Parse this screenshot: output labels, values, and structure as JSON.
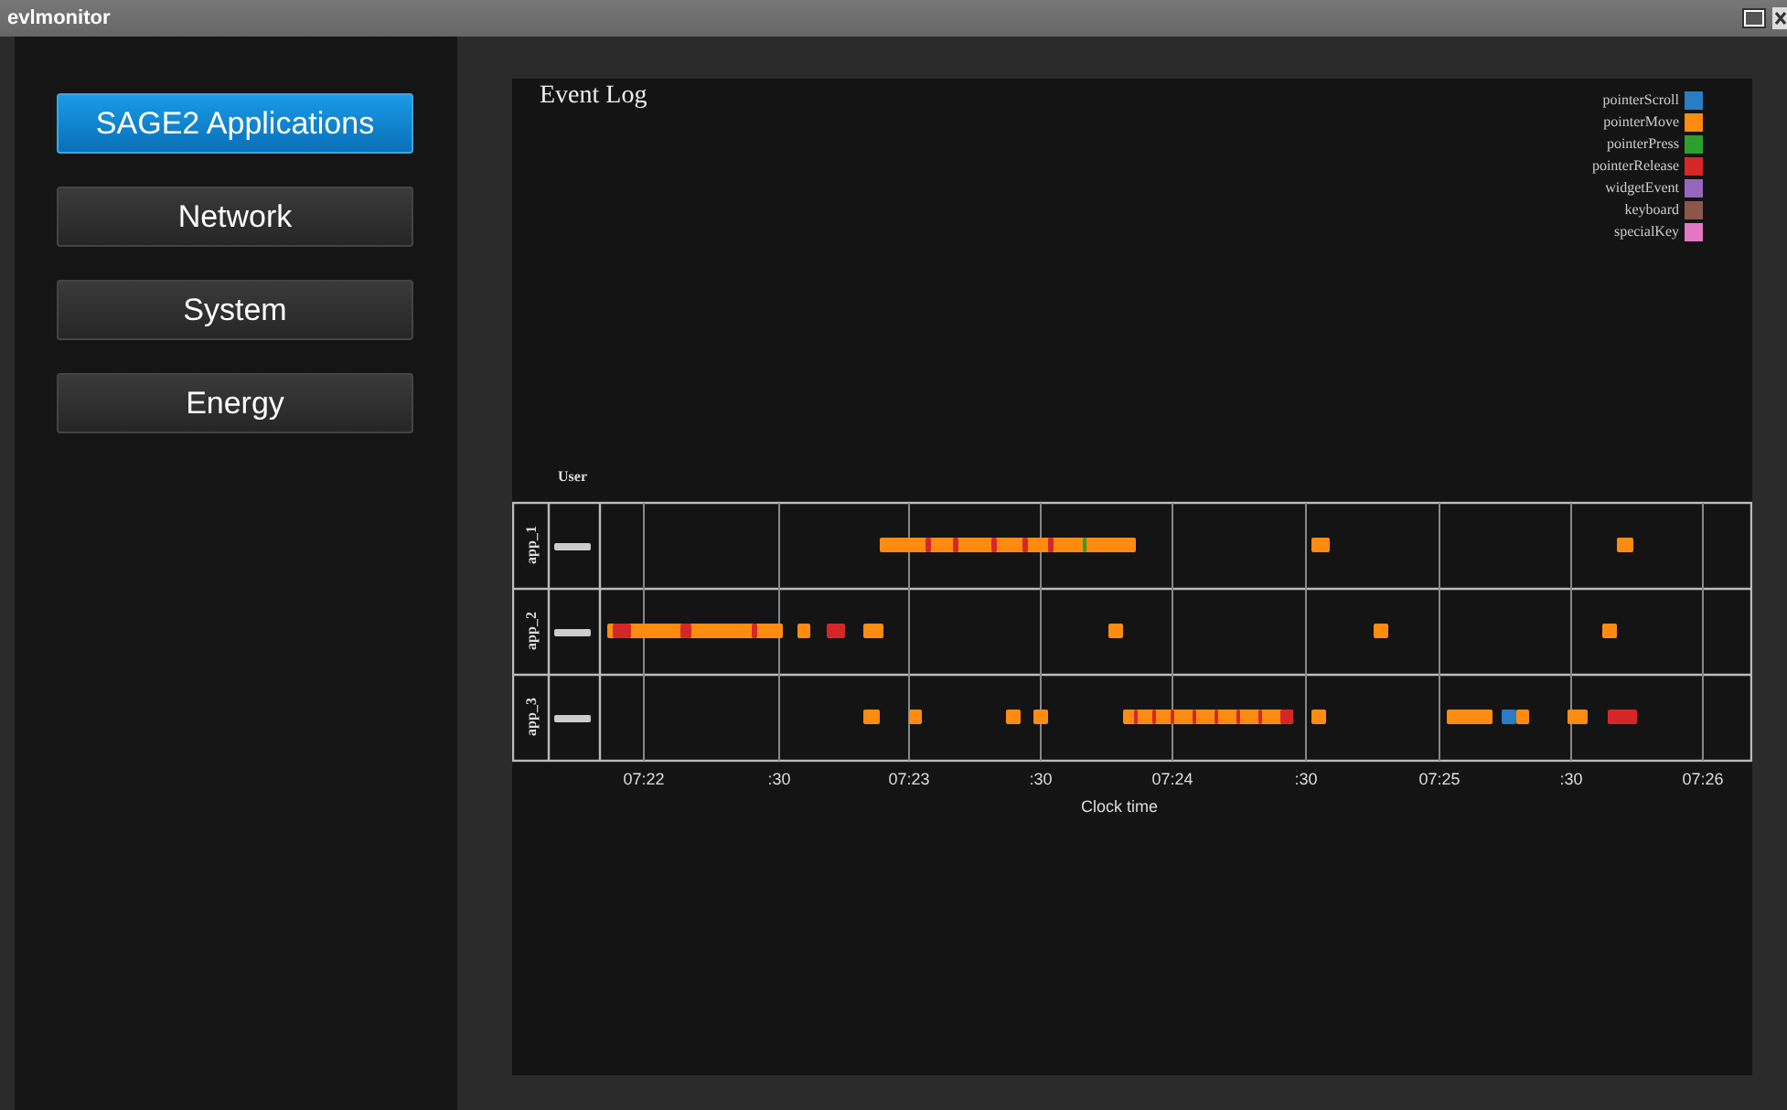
{
  "window": {
    "title": "evlmonitor"
  },
  "sidebar": {
    "items": [
      {
        "label": "SAGE2 Applications",
        "selected": true
      },
      {
        "label": "Network",
        "selected": false
      },
      {
        "label": "System",
        "selected": false
      },
      {
        "label": "Energy",
        "selected": false
      }
    ]
  },
  "event_log": {
    "title": "Event Log",
    "legend": [
      {
        "label": "pointerScroll",
        "color": "#2a7dc4"
      },
      {
        "label": "pointerMove",
        "color": "#ff8c10"
      },
      {
        "label": "pointerPress",
        "color": "#2ca02c"
      },
      {
        "label": "pointerRelease",
        "color": "#d62728"
      },
      {
        "label": "widgetEvent",
        "color": "#9467bd"
      },
      {
        "label": "keyboard",
        "color": "#8c564b"
      },
      {
        "label": "specialKey",
        "color": "#e377c2"
      }
    ],
    "user_column": "User",
    "rows": [
      {
        "label": "app_1"
      },
      {
        "label": "app_2"
      },
      {
        "label": "app_3"
      }
    ],
    "x_ticks": [
      "07:22",
      ":30",
      "07:23",
      ":30",
      "07:24",
      ":30",
      "07:25",
      ":30",
      "07:26"
    ],
    "x_label": "Clock time"
  }
}
